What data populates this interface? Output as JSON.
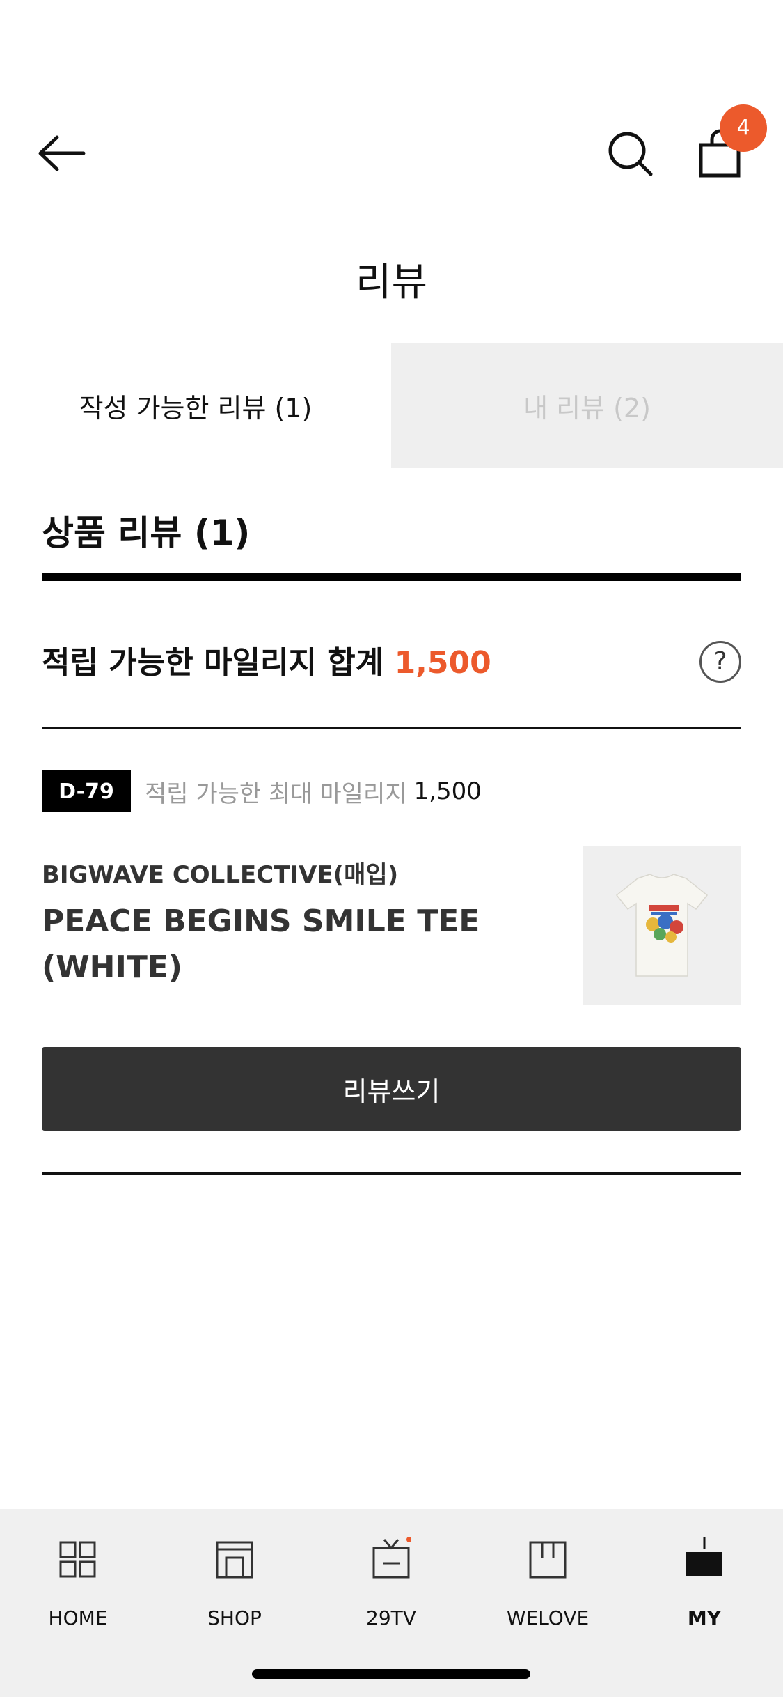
{
  "header": {
    "back_icon": "arrow-left-icon",
    "search_icon": "search-icon",
    "bag_icon": "shopping-bag-icon",
    "bag_count": "4"
  },
  "page": {
    "title": "리뷰"
  },
  "tabs": [
    {
      "label": "작성 가능한 리뷰 (1)",
      "active": true
    },
    {
      "label": "내 리뷰 (2)",
      "active": false
    }
  ],
  "section": {
    "title": "상품 리뷰 (1)",
    "mileage_label": "적립 가능한 마일리지 합계",
    "mileage_value": "1,500",
    "help_label": "?"
  },
  "review_item": {
    "dday": "D-79",
    "max_mileage_label": "적립 가능한 최대 마일리지",
    "max_mileage_value": "1,500",
    "brand": "BIGWAVE COLLECTIVE(매입)",
    "product_name": "PEACE BEGINS SMILE TEE (WHITE)",
    "write_button": "리뷰쓰기"
  },
  "bottom_nav": [
    {
      "label": "HOME",
      "icon": "home-grid-icon"
    },
    {
      "label": "SHOP",
      "icon": "shop-icon"
    },
    {
      "label": "29TV",
      "icon": "tv-icon"
    },
    {
      "label": "WELOVE",
      "icon": "welove-icon"
    },
    {
      "label": "MY",
      "icon": "my-icon",
      "active": true
    }
  ],
  "colors": {
    "accent": "#ec5a2c",
    "button": "#333333",
    "tab_inactive_bg": "#efefef",
    "nav_bg": "#f0f0f0"
  }
}
